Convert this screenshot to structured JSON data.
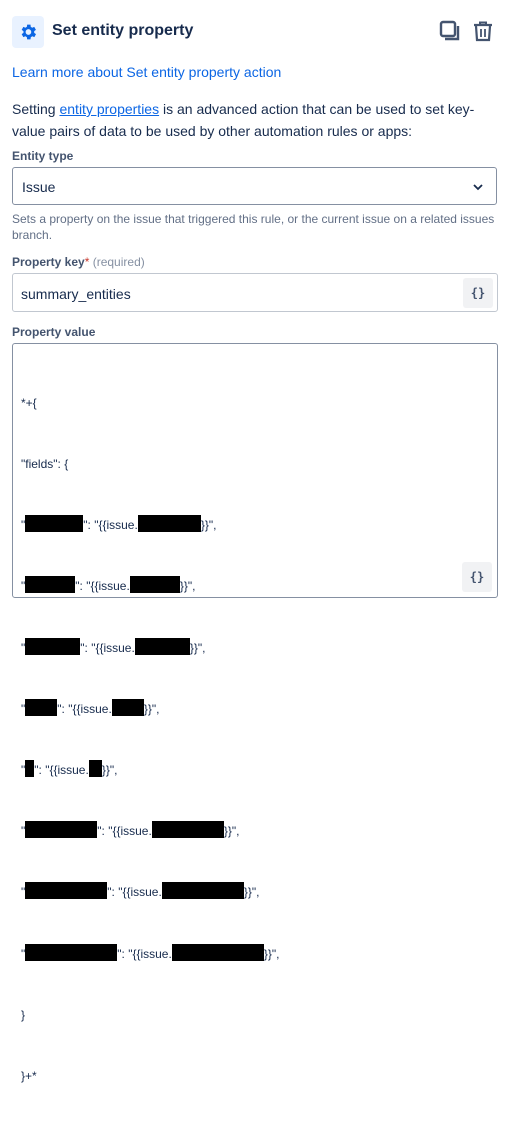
{
  "header": {
    "title": "Set entity property",
    "icons": {
      "action": "gear-icon",
      "duplicate": "duplicate-icon",
      "delete": "trash-icon"
    }
  },
  "learn_more": "Learn more about Set entity property action",
  "description": {
    "prefix": "Setting ",
    "link": "entity properties",
    "suffix": " is an advanced action that can be used to set key-value pairs of data to be used by other automation rules or apps:"
  },
  "entity_type": {
    "label": "Entity type",
    "value": "Issue",
    "help": "Sets a property on the issue that triggered this rule, or the current issue on a related issues branch."
  },
  "property_key": {
    "label": "Property key",
    "required_star": "*",
    "required_text": "(required)",
    "value": "summary_entities",
    "smart_values_button": "{}"
  },
  "property_value": {
    "label": "Property value",
    "smart_values_button": "{}",
    "lines": [
      "*+{",
      "\"fields\": {",
      "\"",
      "\": \"{{issue.",
      "}}\",",
      "}"
    ],
    "close": "}+*"
  },
  "colors": {
    "accent": "#0c66e4",
    "text": "#172b4d",
    "border": "#8590a2"
  }
}
